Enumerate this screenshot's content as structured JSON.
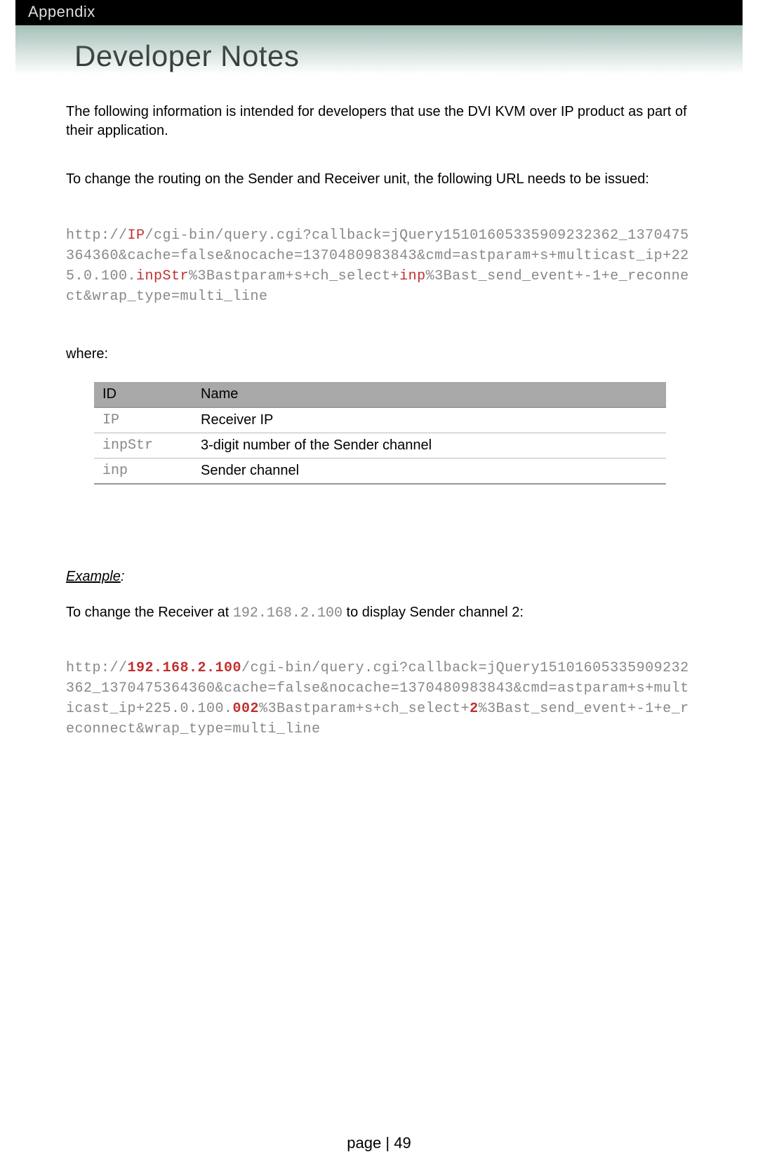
{
  "header": {
    "section": "Appendix",
    "title": "Developer Notes"
  },
  "intro": {
    "p1": "The following information is intended for developers that use the DVI KVM over IP product as part of their application.",
    "p2": "To change the routing on the Sender and Receiver unit, the following URL needs to be issued:"
  },
  "url_template": {
    "s1": "http://",
    "ip": "IP",
    "s2": "/cgi-bin/query.cgi?callback=jQuery15101605335909232362_1370475364360&cache=false&nocache=1370480983843&cmd=astparam+s+multicast_ip+225.0.100.",
    "inpStr": "inpStr",
    "s3": "%3Bastparam+s+ch_select+",
    "inp": "inp",
    "s4": "%3Bast_send_event+-1+e_reconnect&wrap_type=multi_line"
  },
  "where_label": "where:",
  "table": {
    "head": {
      "id": "ID",
      "name": "Name"
    },
    "rows": [
      {
        "id": "IP",
        "name": "Receiver IP"
      },
      {
        "id": "inpStr",
        "name": "3-digit number of the Sender channel"
      },
      {
        "id": "inp",
        "name": "Sender channel"
      }
    ]
  },
  "example": {
    "label": "Example",
    "line_pre": "To change the Receiver at ",
    "line_ip": "192.168.2.100",
    "line_post": " to display Sender channel 2:"
  },
  "url_example": {
    "s1": "http://",
    "ip": "192.168.2.100",
    "s2": "/cgi-bin/query.cgi?callback=jQuery15101605335909232362_1370475364360&cache=false&nocache=1370480983843&cmd=astparam+s+multicast_ip+225.0.100.",
    "inpStr": "002",
    "s3": "%3Bastparam+s+ch_select+",
    "inp": "2",
    "s4": "%3Bast_send_event+-1+e_reconnect&wrap_type=multi_line"
  },
  "footer": {
    "page_label": "page",
    "sep": " | ",
    "num": "49"
  }
}
